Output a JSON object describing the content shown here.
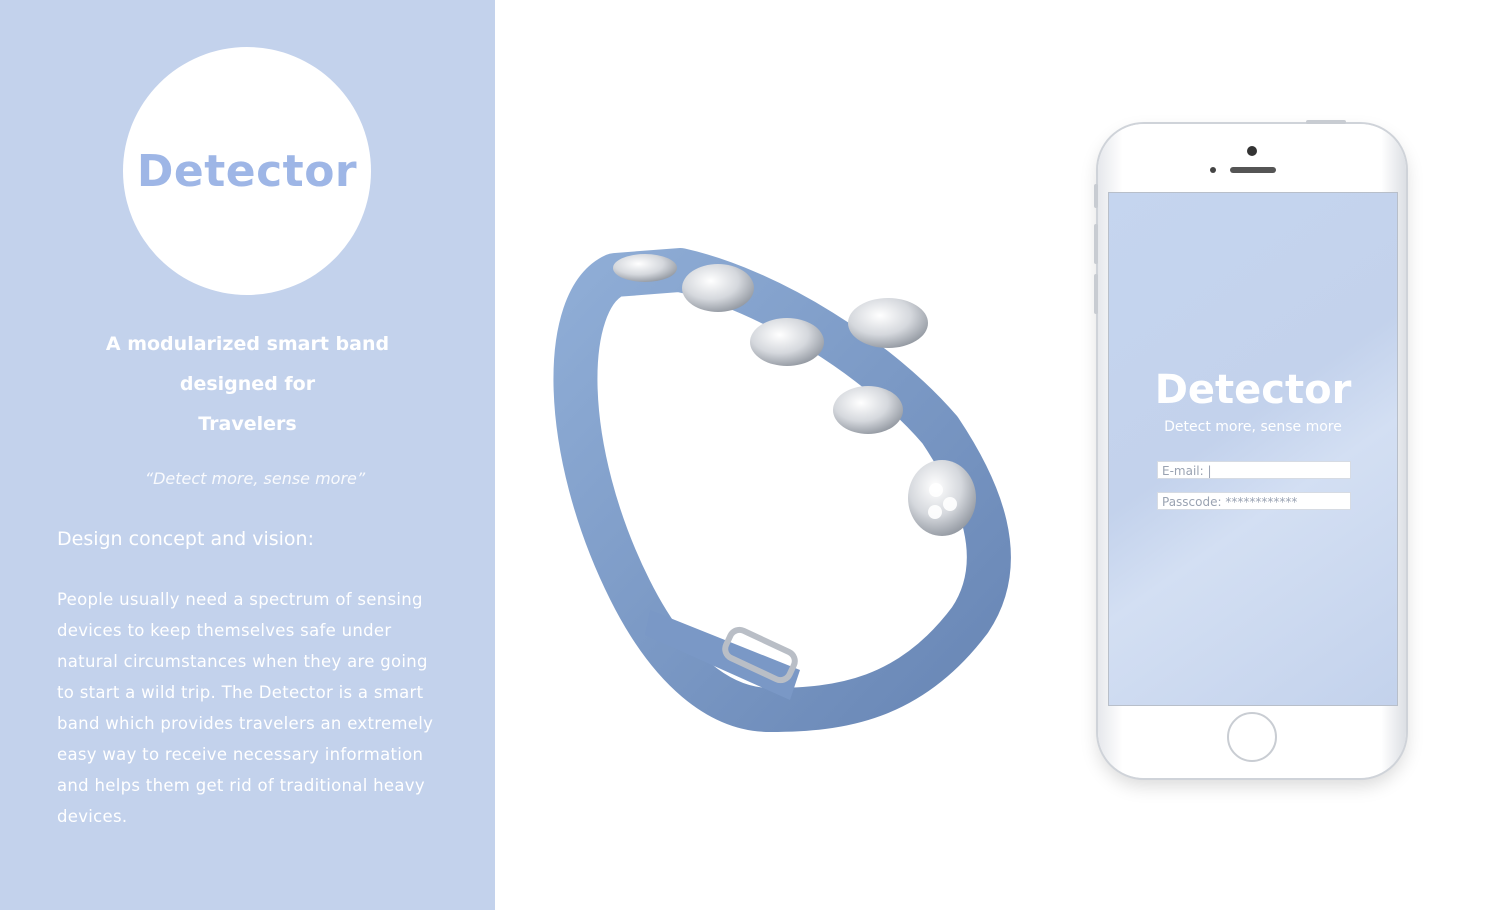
{
  "brand": {
    "name": "Detector"
  },
  "tagline": {
    "line1": "A modularized smart band",
    "line2": "designed for",
    "line3": "Travelers"
  },
  "slogan": "“Detect more, sense more”",
  "concept": {
    "heading": "Design concept and vision:",
    "lines": [
      "People usually need a spectrum of sensing",
      "devices to keep themselves safe under",
      "natural circumstances when they are going",
      "to start a wild trip. The Detector is a smart",
      "band which provides travelers an extremely",
      "easy way to receive necessary information",
      "and helps them get rid of traditional heavy",
      "devices."
    ]
  },
  "phone": {
    "app_title": "Detector",
    "app_subtitle": "Detect more, sense more",
    "email_value": "E-mail: |",
    "passcode_value": "Passcode: ************"
  },
  "colors": {
    "accent": "#c3d2ec",
    "band": "#7b9bc9",
    "logo_text": "#9eb6e6"
  }
}
